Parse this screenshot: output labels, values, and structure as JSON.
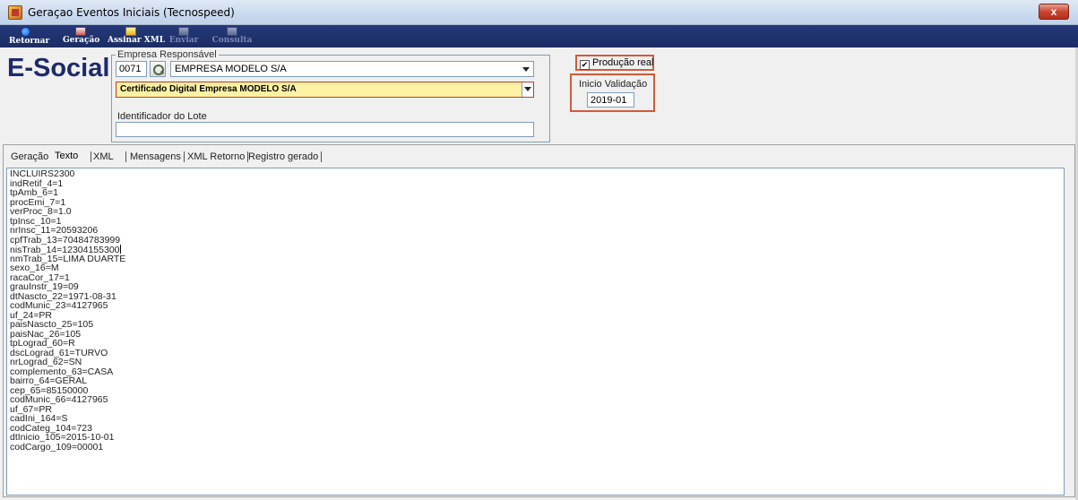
{
  "window": {
    "title": "Geraçao Eventos Iniciais (Tecnospeed)",
    "close_label": "x"
  },
  "toolbar": {
    "buttons": [
      {
        "label": "Retornar",
        "icon": "back-arrow-icon",
        "enabled": true
      },
      {
        "label": "Geração",
        "icon": "generate-icon",
        "enabled": true
      },
      {
        "label": "Assinar XML",
        "icon": "sign-xml-icon",
        "enabled": true
      },
      {
        "label": "Enviar",
        "icon": "send-icon",
        "enabled": false
      },
      {
        "label": "Consulta",
        "icon": "query-icon",
        "enabled": false
      }
    ]
  },
  "header": {
    "logo_text": "E-Social",
    "empresa": {
      "legend": "Empresa Responsável",
      "code": "0071",
      "name": "EMPRESA MODELO S/A",
      "certificate": "Certificado Digital Empresa MODELO S/A",
      "lote_label": "Identificador do Lote",
      "lote_value": ""
    },
    "producao_real": {
      "label": "Produção real",
      "checked": true
    },
    "inicio_validacao": {
      "label": "Inicio Validação",
      "value": "2019-01"
    }
  },
  "tabs": [
    {
      "label": "Geração",
      "active": false
    },
    {
      "label": "Texto",
      "active": true
    },
    {
      "label": "XML",
      "active": false
    },
    {
      "label": "Mensagens",
      "active": false
    },
    {
      "label": "XML Retorno",
      "active": false
    },
    {
      "label": "Registro gerado",
      "active": false
    }
  ],
  "text_lines": [
    "INCLUIRS2300",
    "indRetif_4=1",
    "tpAmb_6=1",
    "procEmi_7=1",
    "verProc_8=1.0",
    "tpInsc_10=1",
    "nrInsc_11=20593206",
    "cpfTrab_13=70484783999",
    "nisTrab_14=12304155300",
    "nmTrab_15=LIMA DUARTE",
    "sexo_16=M",
    "racaCor_17=1",
    "grauInstr_19=09",
    "dtNascto_22=1971-08-31",
    "codMunic_23=4127965",
    "uf_24=PR",
    "paisNascto_25=105",
    "paisNac_26=105",
    "tpLograd_60=R",
    "dscLograd_61=TURVO",
    "nrLograd_62=SN",
    "complemento_63=CASA",
    "bairro_64=GERAL",
    "cep_65=85150000",
    "codMunic_66=4127965",
    "uf_67=PR",
    "cadIni_164=S",
    "codCateg_104=723",
    "dtInicio_105=2015-10-01",
    "codCargo_109=00001"
  ]
}
